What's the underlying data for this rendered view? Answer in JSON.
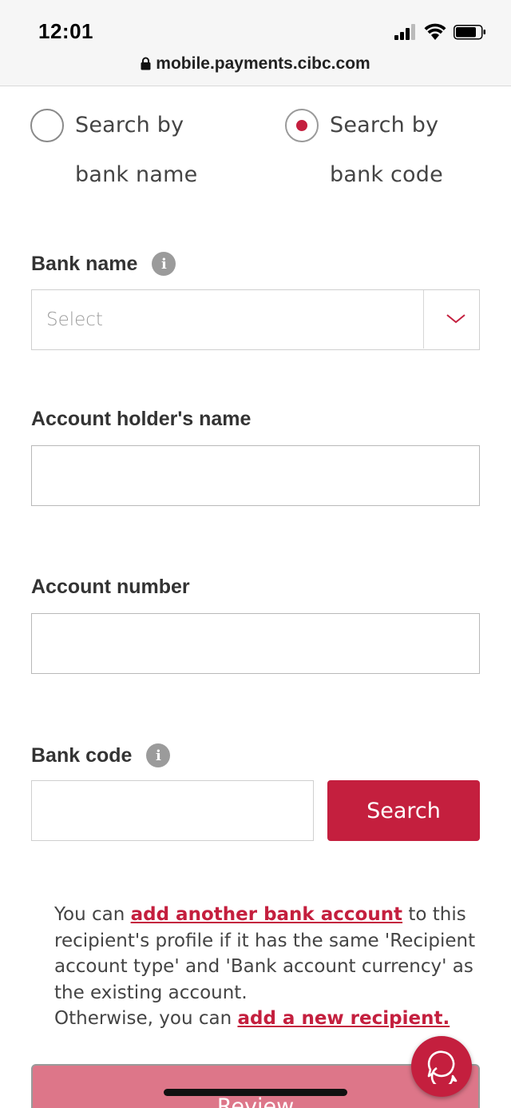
{
  "status_bar": {
    "time": "12:01",
    "url": "mobile.payments.cibc.com",
    "icons": [
      "signal-icon",
      "wifi-icon",
      "battery-icon"
    ]
  },
  "search_options": [
    {
      "label": "Search by bank name",
      "selected": false
    },
    {
      "label": "Search by bank code",
      "selected": true
    }
  ],
  "bank_name": {
    "label": "Bank name",
    "select_value": "Select"
  },
  "account_holder": {
    "label": "Account holder's name",
    "value": ""
  },
  "account_number": {
    "label": "Account number",
    "value": ""
  },
  "bank_code": {
    "label": "Bank code",
    "value": "",
    "search_label": "Search"
  },
  "note": {
    "part1": "You can ",
    "link1": "add another bank account",
    "part2": " to this recipient's profile if it has the same 'Recipient account type' and 'Bank account currency' as the existing account.",
    "part3": "Otherwise, you can ",
    "link2": "add a new recipient."
  },
  "review_label": "Review",
  "colors": {
    "accent": "#c41f3e",
    "review_disabled": "#dd7689",
    "info_icon": "#9b9b9b"
  }
}
